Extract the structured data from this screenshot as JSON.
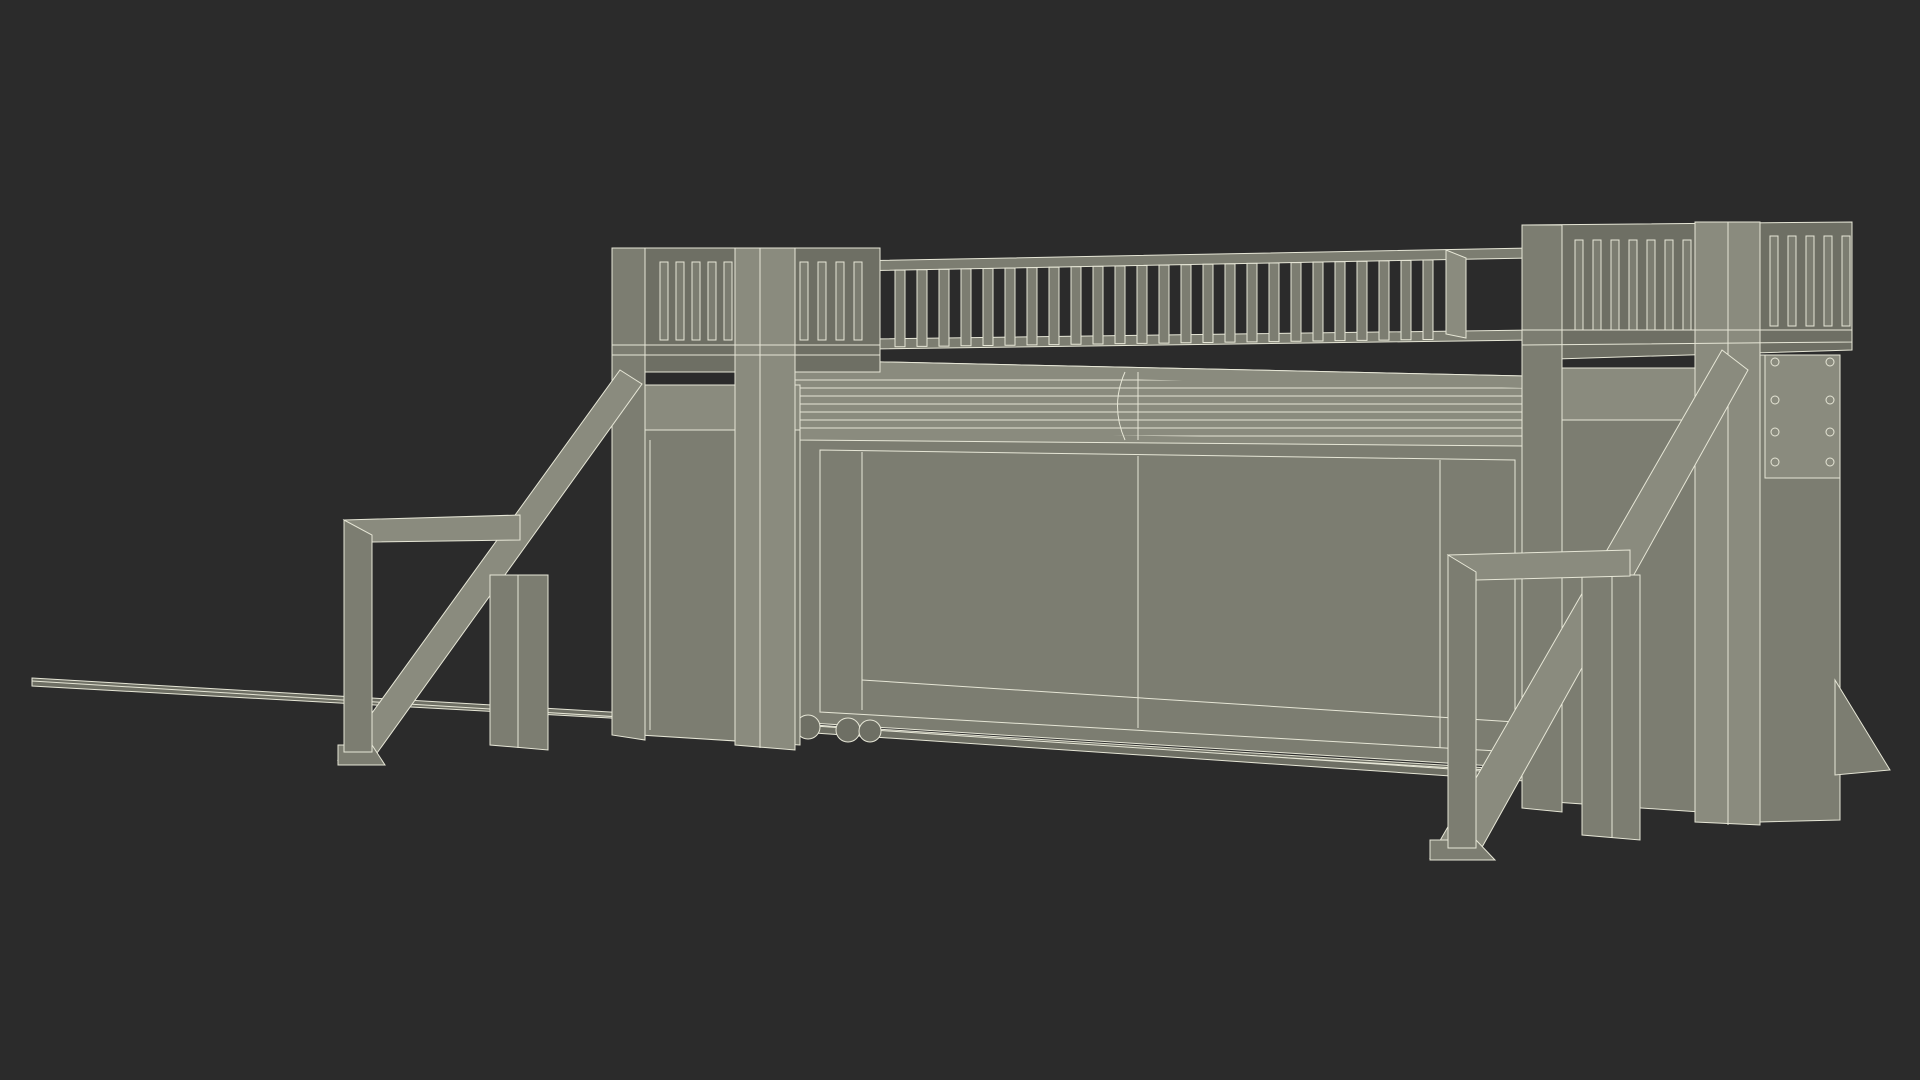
{
  "scene": {
    "subject": "gate-barrier-wireframe-render",
    "colors": {
      "background": "#2b2b2b",
      "surface": "#7c7d71",
      "surface_dark": "#6e6f64",
      "surface_light": "#8a8b7e",
      "wire": "#e6e6d6",
      "shadow": "#242424"
    }
  }
}
